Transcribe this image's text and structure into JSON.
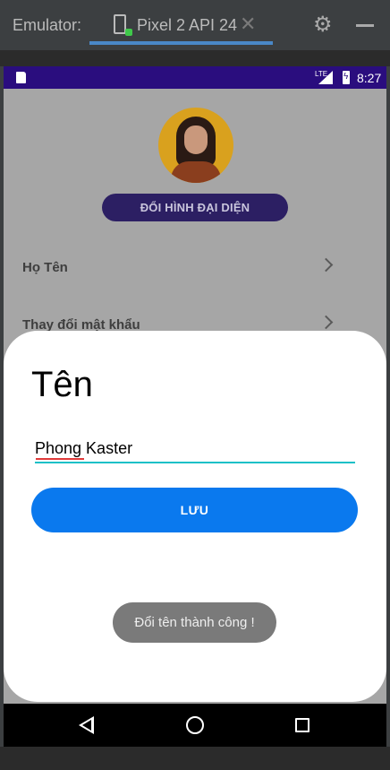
{
  "emulator": {
    "label": "Emulator:",
    "tab_title": "Pixel 2 API 24",
    "close_glyph": "✕",
    "settings_glyph": "⚙",
    "accent": "#4a88c7"
  },
  "status_bar": {
    "time": "8:27",
    "network": "LTE",
    "background": "#2a0d7e"
  },
  "profile": {
    "change_avatar_label": "ĐỔI HÌNH ĐẠI DIỆN",
    "menu": [
      {
        "label": "Họ Tên",
        "icon": "chevron-right-icon"
      },
      {
        "label": "Thay đổi mật khẩu",
        "icon": "chevron-right-icon"
      }
    ]
  },
  "sheet": {
    "title": "Tên",
    "name_value": "Phong Kaster",
    "save_label": "LƯU",
    "accent": "#0a79ee"
  },
  "toast": {
    "message": "Đổi tên thành công !"
  },
  "nav": {
    "back_icon": "back-triangle-icon",
    "home_icon": "home-circle-icon",
    "recents_icon": "recents-square-icon"
  }
}
